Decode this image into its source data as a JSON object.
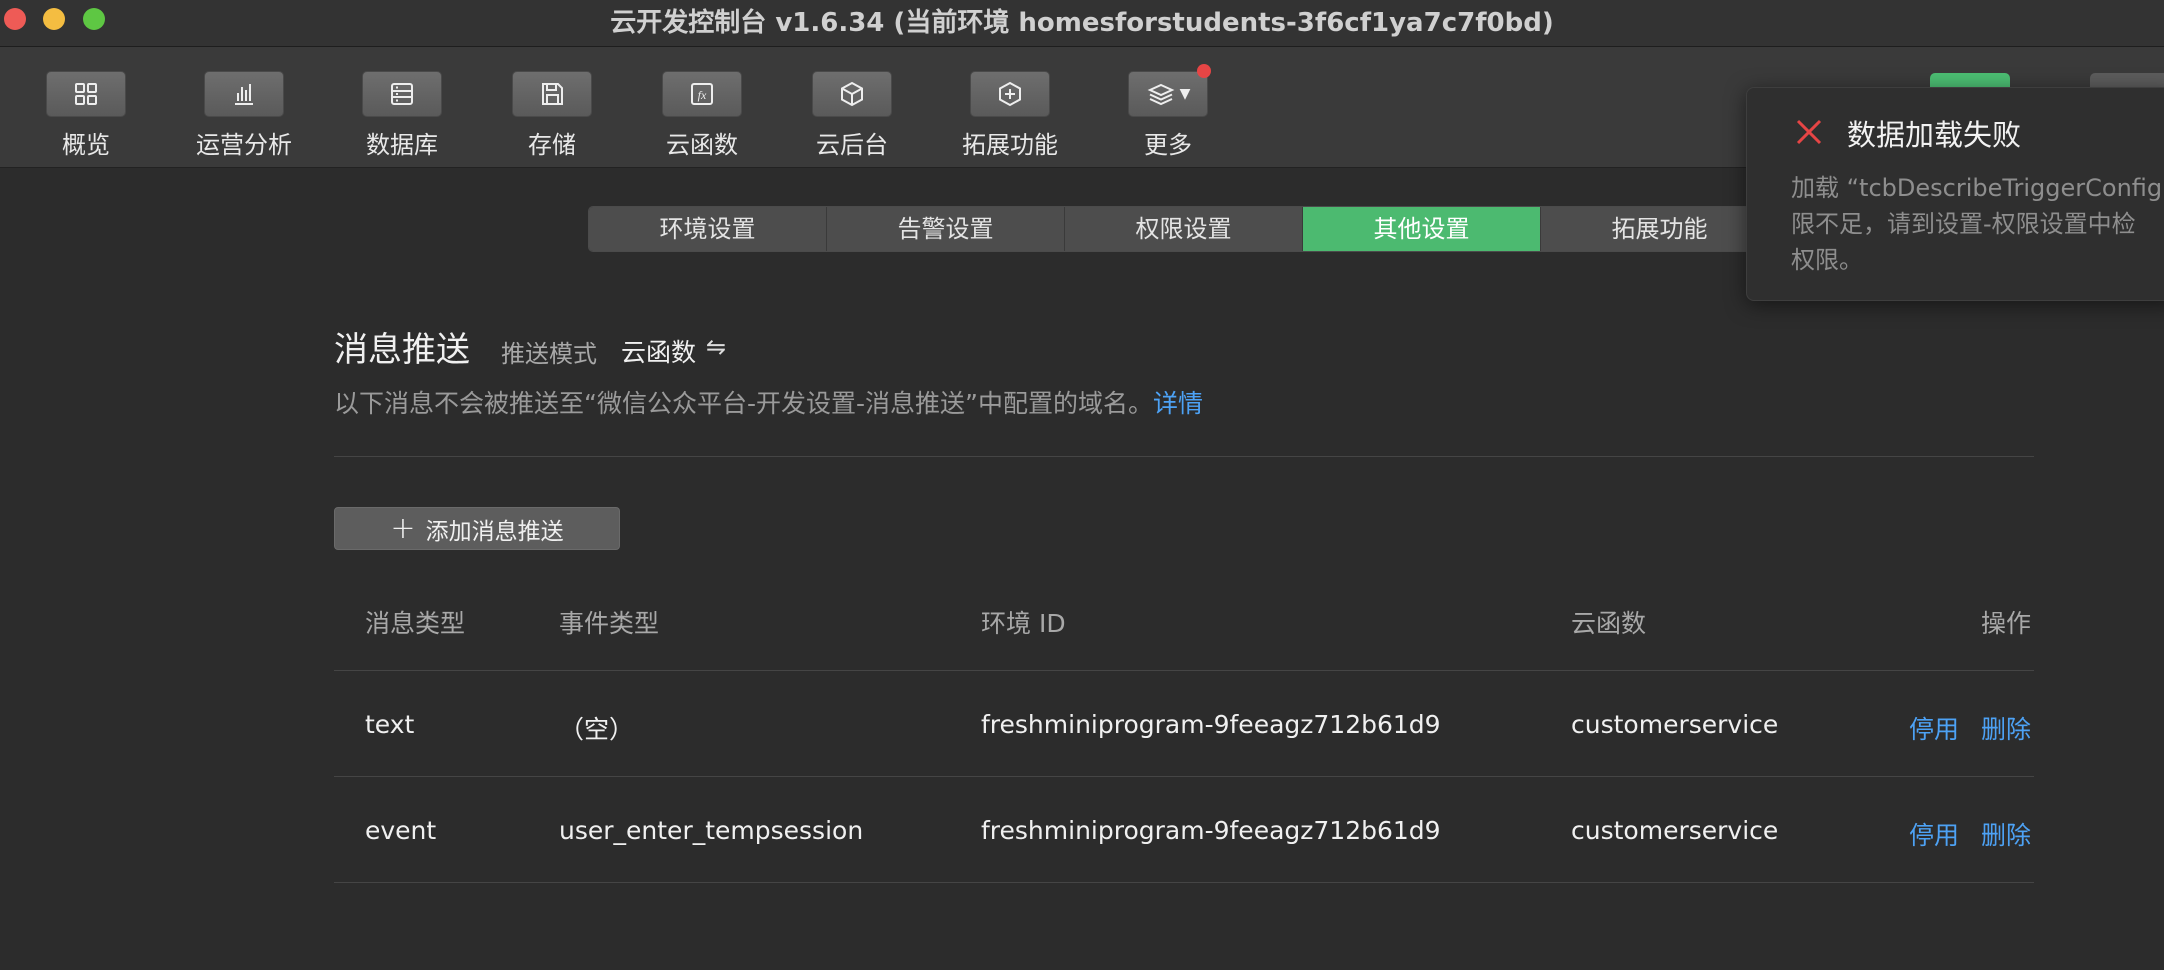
{
  "window": {
    "title": "云开发控制台 v1.6.34 (当前环境 homesforstudents-3f6cf1ya7c7f0bd)"
  },
  "toolbar": {
    "items": [
      {
        "label": "概览",
        "icon": "grid-icon"
      },
      {
        "label": "运营分析",
        "icon": "bar-chart-icon"
      },
      {
        "label": "数据库",
        "icon": "database-icon"
      },
      {
        "label": "存储",
        "icon": "floppy-disk-icon"
      },
      {
        "label": "云函数",
        "icon": "function-icon"
      },
      {
        "label": "云后台",
        "icon": "cube-icon"
      },
      {
        "label": "拓展功能",
        "icon": "extension-icon"
      },
      {
        "label": "更多",
        "icon": "layers-icon",
        "has_notification": true
      }
    ]
  },
  "tabs": [
    {
      "label": "环境设置",
      "active": false
    },
    {
      "label": "告警设置",
      "active": false
    },
    {
      "label": "权限设置",
      "active": false
    },
    {
      "label": "其他设置",
      "active": true
    },
    {
      "label": "拓展功能",
      "active": false
    }
  ],
  "section": {
    "title": "消息推送",
    "push_mode_label": "推送模式",
    "push_mode_value": "云函数",
    "swap_icon": "⇋",
    "description": "以下消息不会被推送至“微信公众平台-开发设置-消息推送”中配置的域名。",
    "details_link": "详情"
  },
  "add_button": {
    "label": "添加消息推送"
  },
  "table": {
    "headers": {
      "message_type": "消息类型",
      "event_type": "事件类型",
      "env_id": "环境 ID",
      "function": "云函数",
      "actions": "操作"
    },
    "rows": [
      {
        "message_type": "text",
        "event_type": "（空）",
        "env_id": "freshminiprogram-9feeagz712b61d9",
        "function": "customerservice",
        "disable": "停用",
        "delete": "删除"
      },
      {
        "message_type": "event",
        "event_type": "user_enter_tempsession",
        "env_id": "freshminiprogram-9feeagz712b61d9",
        "function": "customerservice",
        "disable": "停用",
        "delete": "删除"
      }
    ]
  },
  "toast": {
    "title": "数据加载失败",
    "message": "加载 “tcbDescribeTriggerConfig” 权限不足，请到设置-权限设置中检查权限。",
    "message_lines": [
      "加载 “tcbDescribeTriggerConfig",
      "限不足，请到设置-权限设置中检",
      "权限。"
    ]
  },
  "colors": {
    "accent_green": "#4cba70",
    "link_blue": "#4da2f5",
    "error_red": "#e64545",
    "background": "#2c2c2c"
  }
}
